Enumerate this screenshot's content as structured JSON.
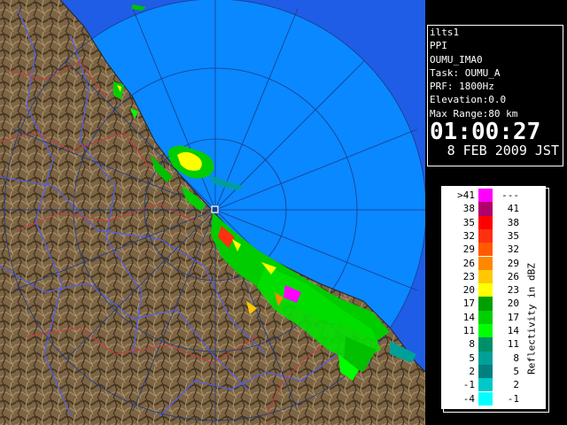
{
  "info": {
    "site": "ilts1",
    "mode": "PPI",
    "product": "OUMU_IMA0",
    "task": "Task: OUMU_A",
    "prf": "PRF: 1800Hz",
    "elevation": "Elevation:0.0",
    "max_range": "Max Range:80 km",
    "time": "01:00:27",
    "date": "8 FEB 2009 JST"
  },
  "legend": {
    "title": "Reflectivity in dBZ",
    "rows": [
      {
        "hi": ">41",
        "lo": "---",
        "color": "#ff00ff"
      },
      {
        "hi": "38",
        "lo": "41",
        "color": "#b0006a"
      },
      {
        "hi": "35",
        "lo": "38",
        "color": "#ff0000"
      },
      {
        "hi": "32",
        "lo": "35",
        "color": "#ff3010"
      },
      {
        "hi": "29",
        "lo": "32",
        "color": "#ff5a00"
      },
      {
        "hi": "26",
        "lo": "29",
        "color": "#ff8800"
      },
      {
        "hi": "23",
        "lo": "26",
        "color": "#ffc800"
      },
      {
        "hi": "20",
        "lo": "23",
        "color": "#ffff00"
      },
      {
        "hi": "17",
        "lo": "20",
        "color": "#00a000"
      },
      {
        "hi": "14",
        "lo": "17",
        "color": "#00d000"
      },
      {
        "hi": "11",
        "lo": "14",
        "color": "#00ff00"
      },
      {
        "hi": "8",
        "lo": "11",
        "color": "#009068"
      },
      {
        "hi": "5",
        "lo": "8",
        "color": "#00a098"
      },
      {
        "hi": "2",
        "lo": "5",
        "color": "#008080"
      },
      {
        "hi": "-1",
        "lo": "2",
        "color": "#00c8c8"
      },
      {
        "hi": "-4",
        "lo": "-1",
        "color": "#00ffff"
      }
    ]
  },
  "map": {
    "sea_color": "#0080ff",
    "outer_sea_color": "#1060e8",
    "land_color": "#7a6442"
  }
}
